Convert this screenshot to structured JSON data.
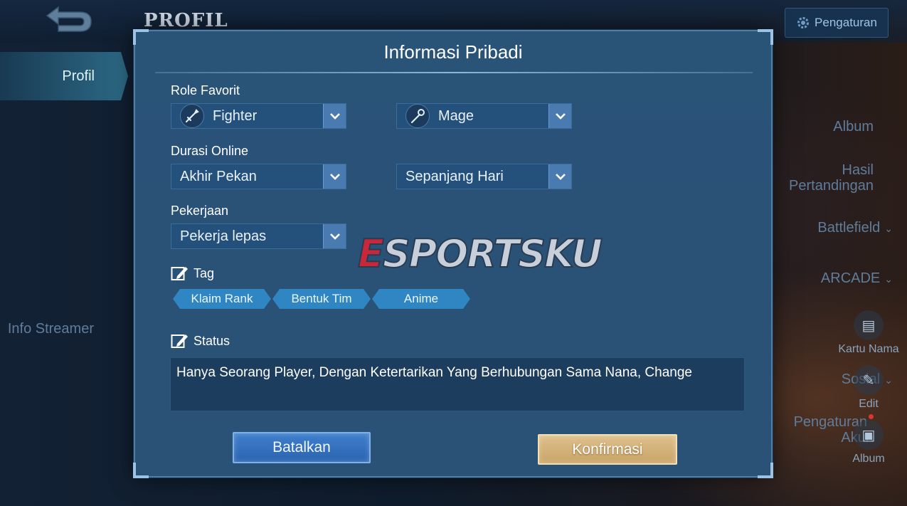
{
  "background": {
    "page_title": "PROFIL",
    "settings_label": "Pengaturan",
    "sidebar": [
      {
        "label": "Profil",
        "active": true
      },
      {
        "label": "Album"
      },
      {
        "label_line1": "Hasil",
        "label_line2": "Pertandingan"
      },
      {
        "label": "Battlefield",
        "has_chevron": true
      },
      {
        "label": "ARCADE",
        "has_chevron": true
      },
      {
        "label": "Info Streamer"
      },
      {
        "label": "Sosial",
        "has_chevron": true
      },
      {
        "label_line1": "Pengaturan",
        "label_line2": "Akun",
        "has_dot": true
      }
    ],
    "right_tools": [
      {
        "label": "Kartu Nama",
        "icon": "card-icon"
      },
      {
        "label": "Edit",
        "icon": "edit-icon"
      },
      {
        "label": "Album",
        "icon": "image-icon"
      }
    ]
  },
  "modal": {
    "title": "Informasi Pribadi",
    "role_label": "Role Favorit",
    "role_1": {
      "value": "Fighter",
      "icon": "sword-icon"
    },
    "role_2": {
      "value": "Mage",
      "icon": "staff-icon"
    },
    "duration_label": "Durasi Online",
    "duration_1": "Akhir Pekan",
    "duration_2": "Sepanjang Hari",
    "job_label": "Pekerjaan",
    "job": "Pekerja lepas",
    "tag_label": "Tag",
    "tags": [
      "Klaim Rank",
      "Bentuk Tim",
      "Anime"
    ],
    "status_label": "Status",
    "status_text": "Hanya Seorang Player, Dengan Ketertarikan Yang Berhubungan Sama Nana, Change",
    "cancel_label": "Batalkan",
    "confirm_label": "Konfirmasi"
  },
  "watermark": {
    "first": "E",
    "rest": "SPORTSKU"
  },
  "colors": {
    "modal_bg": "#2a5277",
    "dropdown_bg": "#24507c",
    "dropdown_arrow": "#4a7bb0",
    "tag_chip": "#2f86c2",
    "cancel_btn": "#3f7fcd",
    "confirm_btn": "#d6b67d"
  }
}
